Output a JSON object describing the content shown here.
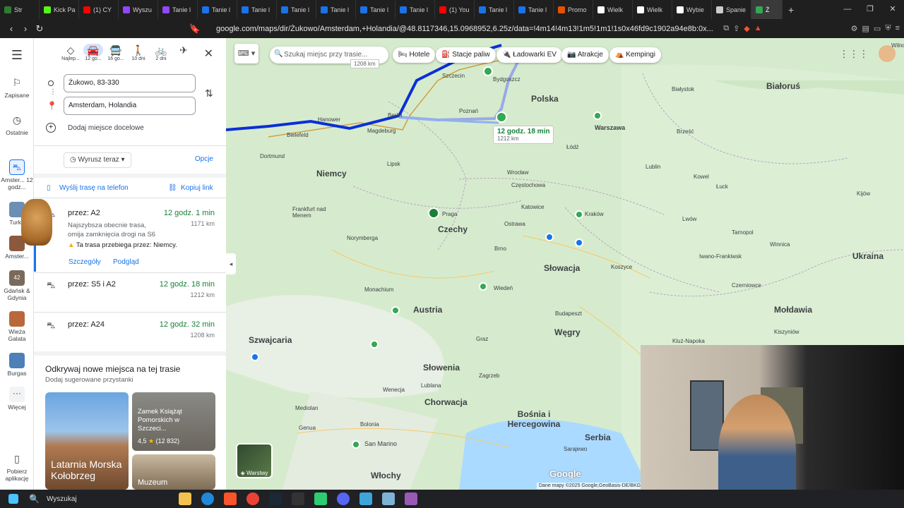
{
  "browser": {
    "tabs": [
      {
        "label": "Str",
        "color": "#2e7d32"
      },
      {
        "label": "Kick Pa",
        "color": "#53fc18"
      },
      {
        "label": "(1) CY",
        "color": "#ff0000"
      },
      {
        "label": "Wyszu",
        "color": "#9146ff"
      },
      {
        "label": "Tanie l",
        "color": "#9146ff"
      },
      {
        "label": "Tanie l",
        "color": "#1a73e8"
      },
      {
        "label": "Tanie l",
        "color": "#1a73e8"
      },
      {
        "label": "Tanie l",
        "color": "#1a73e8"
      },
      {
        "label": "Tanie l",
        "color": "#1a73e8"
      },
      {
        "label": "Tanie l",
        "color": "#1a73e8"
      },
      {
        "label": "Tanie l",
        "color": "#1a73e8"
      },
      {
        "label": "(1) You",
        "color": "#ff0000"
      },
      {
        "label": "Tanie l",
        "color": "#1a73e8"
      },
      {
        "label": "Tanie l",
        "color": "#1a73e8"
      },
      {
        "label": "Promo",
        "color": "#e65100"
      },
      {
        "label": "Wielk",
        "color": "#ffffff"
      },
      {
        "label": "Wielk",
        "color": "#ffffff"
      },
      {
        "label": "Wybie",
        "color": "#ffffff"
      },
      {
        "label": "Spanie",
        "color": "#cccccc"
      },
      {
        "label": "Ż",
        "color": "#34a853"
      }
    ],
    "url": "google.com/maps/dir/Żukowo/Amsterdam,+Holandia/@48.8117346,15.0968952,6.25z/data=!4m14!4m13!1m5!1m1!1s0x46fd9c1902a94e8b:0x..."
  },
  "rail": {
    "items": [
      {
        "label": "Zapisane"
      },
      {
        "label": "Ostatnie"
      },
      {
        "label": "Amster... 12 godz..."
      },
      {
        "label": "Turku"
      },
      {
        "label": "Amster..."
      },
      {
        "label": "Gdańsk & Gdynia"
      },
      {
        "label": "Wieża Galata"
      },
      {
        "label": "Burgas"
      },
      {
        "label": "Więcej"
      },
      {
        "label": "Pobierz aplikację"
      }
    ]
  },
  "modes": [
    {
      "label": "Najlep..."
    },
    {
      "label": "12 go..."
    },
    {
      "label": "16 go..."
    },
    {
      "label": "10 dni"
    },
    {
      "label": "2 dni"
    }
  ],
  "directions": {
    "origin": "Żukowo, 83-330",
    "destination": "Amsterdam, Holandia",
    "add_destination": "Dodaj miejsce docelowe",
    "depart": "Wyrusz teraz",
    "options": "Opcje",
    "send_to_phone": "Wyślij trasę na telefon",
    "copy_link": "Kopiuj link"
  },
  "routes": [
    {
      "via": "przez: A2",
      "time": "12 godz. 1 min",
      "distance": "1171 km",
      "desc1": "Najszybsza obecnie trasa,",
      "desc2": "omija zamknięcia drogi na S6",
      "warning": "Ta trasa przebiega przez: Niemcy.",
      "details": "Szczegóły",
      "preview": "Podgląd"
    },
    {
      "via": "przez: S5 i A2",
      "time": "12 godz. 18 min",
      "distance": "1212 km"
    },
    {
      "via": "przez: A24",
      "time": "12 godz. 32 min",
      "distance": "1208 km"
    }
  ],
  "discover": {
    "title": "Odkrywaj nowe miejsca na tej trasie",
    "subtitle": "Dodaj sugerowane przystanki",
    "cards": [
      {
        "title": "Latarnia Morska Kołobrzeg"
      },
      {
        "title": "Zamek Książąt Pomorskich w Szczeci...",
        "rating": "4,5",
        "reviews": "(12 832)"
      },
      {
        "title": "Muzeum"
      }
    ]
  },
  "map": {
    "search_placeholder": "Szukaj miejsc przy trasie...",
    "chips": [
      "Hotele",
      "Stacje paliw",
      "Ładowarki EV",
      "Atrakcje",
      "Kempingi"
    ],
    "route_label_time": "12 godz. 18 min",
    "route_label_km": "1212 km",
    "small_label": "1208 km",
    "layers": "Warstwy",
    "attribution": "Dane mapy ©2025 Google,GeoBasis-DE/BKG (©2...",
    "countries": [
      "Niemcy",
      "Czechy",
      "Polska",
      "Białoruś",
      "Ukraina",
      "Słowacja",
      "Austria",
      "Węgry",
      "Mołdawia",
      "Szwajcaria",
      "Słowenia",
      "Chorwacja",
      "Bośnia i Hercegowina",
      "Serbia",
      "Włochy"
    ],
    "cities": [
      "Szczecin",
      "Berlin",
      "Hanower",
      "Magdeburg",
      "Bielefeld",
      "Dortmund",
      "Lipsk",
      "Frankfurt nad Menem",
      "Norymberga",
      "Praga",
      "Wrocław",
      "Częstochowa",
      "Katowice",
      "Kraków",
      "Ostrawa",
      "Brno",
      "Warszawa",
      "Łódź",
      "Lublin",
      "Lwów",
      "Iwano-Frankiwsk",
      "Tarnopol",
      "Winnica",
      "Kijów",
      "Koszyce",
      "Budapeszt",
      "Wiedeń",
      "Monachium",
      "Graz",
      "Zagrzeb",
      "Lublana",
      "Wenecja",
      "Mediolan",
      "Bolonia",
      "Genua",
      "San Marino",
      "Sarajewo",
      "Kluż-Napoka",
      "Kiszyniów",
      "Czerniowce",
      "Brześć",
      "Łuck",
      "Kowel",
      "Białystok",
      "Bydgoszcz",
      "Poznań",
      "Wilno"
    ]
  },
  "taskbar": {
    "search": "Wyszukaj"
  }
}
